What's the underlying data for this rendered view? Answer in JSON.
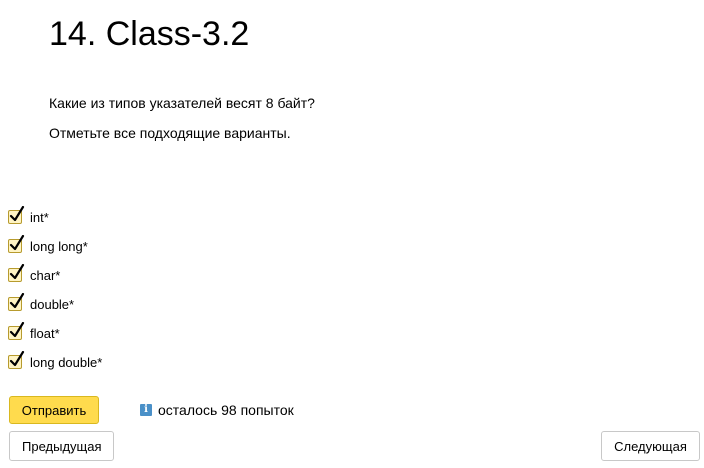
{
  "header": {
    "title": "14. Class-3.2"
  },
  "question": {
    "text": "Какие из типов указателей весят 8 байт?",
    "instruction": "Отметьте все подходящие варианты."
  },
  "options": [
    {
      "label": "int*",
      "checked": true
    },
    {
      "label": "long long*",
      "checked": true
    },
    {
      "label": "char*",
      "checked": true
    },
    {
      "label": "double*",
      "checked": true
    },
    {
      "label": "float*",
      "checked": true
    },
    {
      "label": "long double*",
      "checked": true
    }
  ],
  "actions": {
    "submit_label": "Отправить",
    "attempts_text": "осталось 98 попыток",
    "info_icon": "info-icon",
    "prev_label": "Предыдущая",
    "next_label": "Следующая"
  },
  "colors": {
    "accent": "#ffdb4d",
    "checkbox_bg": "#fff4c4",
    "info": "#4a90c8"
  }
}
